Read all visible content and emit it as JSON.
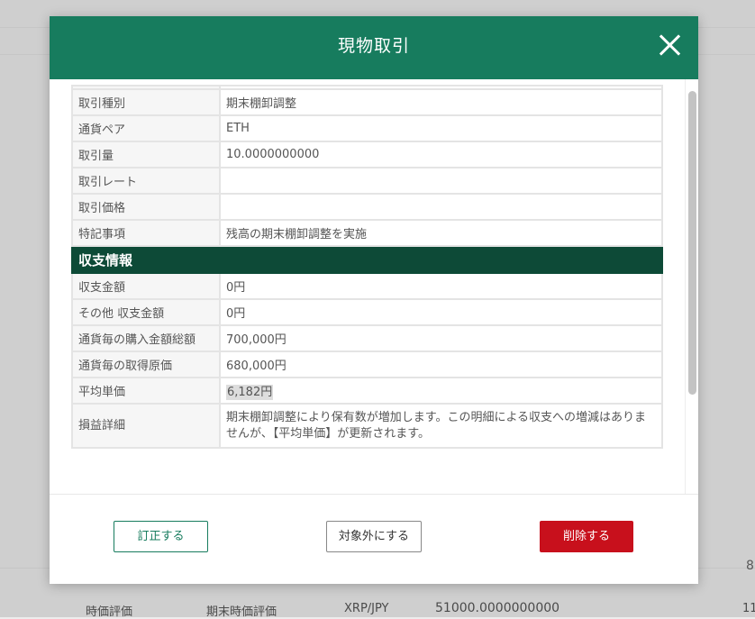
{
  "background": {
    "bottom_row": [
      "時価評価",
      "期末時価評価",
      "XRP/JPY",
      "51000.0000000000",
      "11"
    ],
    "side_number": "8"
  },
  "modal": {
    "title": "現物取引",
    "rows_top": [
      {
        "label": "取引種別",
        "value": "期末棚卸調整"
      },
      {
        "label": "通貨ペア",
        "value": "ETH"
      },
      {
        "label": "取引量",
        "value": "10.0000000000"
      },
      {
        "label": "取引レート",
        "value": ""
      },
      {
        "label": "取引価格",
        "value": ""
      },
      {
        "label": "特記事項",
        "value": "残高の期末棚卸調整を実施"
      }
    ],
    "section_title": "収支情報",
    "rows_bottom": [
      {
        "label": "収支金額",
        "value": "0円"
      },
      {
        "label": "その他 収支金額",
        "value": "0円"
      },
      {
        "label": "通貨毎の購入金額総額",
        "value": "700,000円"
      },
      {
        "label": "通貨毎の取得原価",
        "value": "680,000円"
      },
      {
        "label": "平均単価",
        "value": "6,182円"
      },
      {
        "label": "損益詳細",
        "value": "期末棚卸調整により保有数が増加します。この明細による収支への増減はありませんが、【平均単価】が更新されます。"
      }
    ],
    "buttons": {
      "edit": "訂正する",
      "exclude": "対象外にする",
      "delete": "削除する"
    }
  }
}
